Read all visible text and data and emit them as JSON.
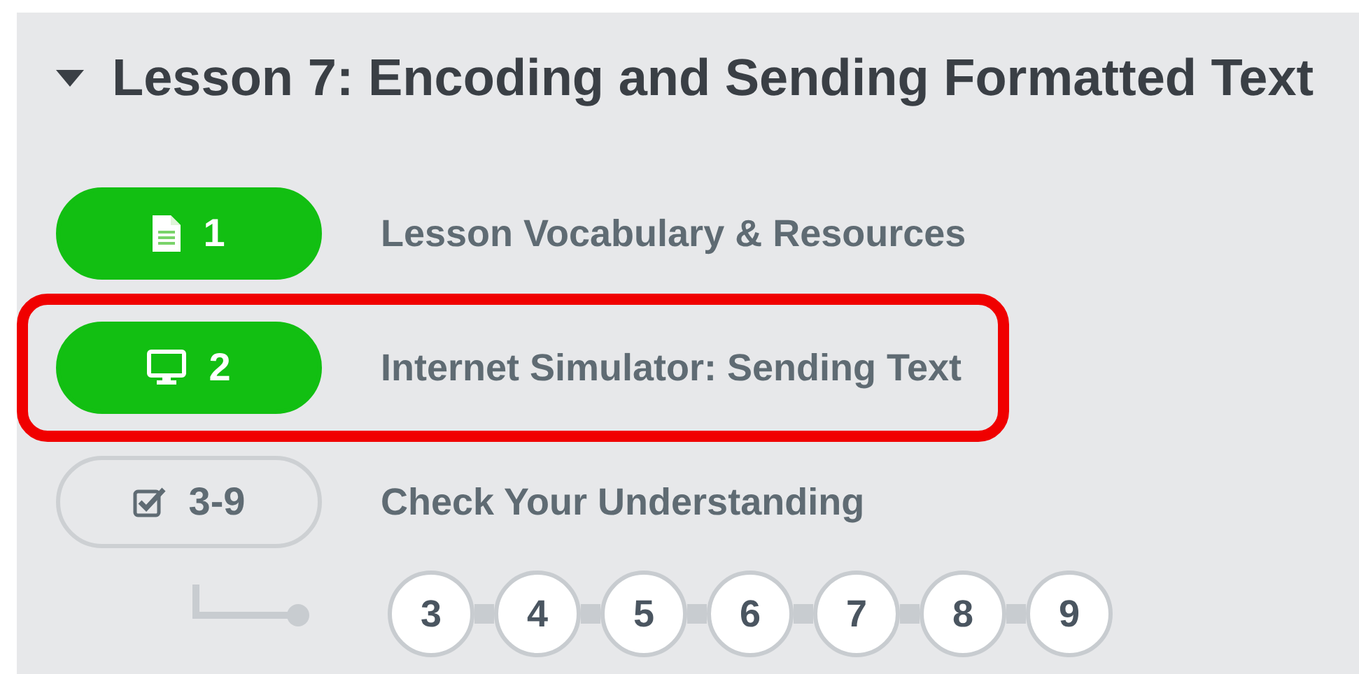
{
  "lesson": {
    "title": "Lesson 7: Encoding and Sending Formatted Text",
    "expanded": true
  },
  "items": [
    {
      "kind": "resource",
      "badge": "1",
      "label": "Lesson Vocabulary & Resources",
      "completed": true,
      "highlighted": false
    },
    {
      "kind": "activity",
      "badge": "2",
      "label": "Internet Simulator: Sending Text",
      "completed": true,
      "highlighted": true
    },
    {
      "kind": "assessment",
      "badge": "3-9",
      "label": "Check Your Understanding",
      "completed": false,
      "highlighted": false
    }
  ],
  "levels": [
    "3",
    "4",
    "5",
    "6",
    "7",
    "8",
    "9"
  ]
}
